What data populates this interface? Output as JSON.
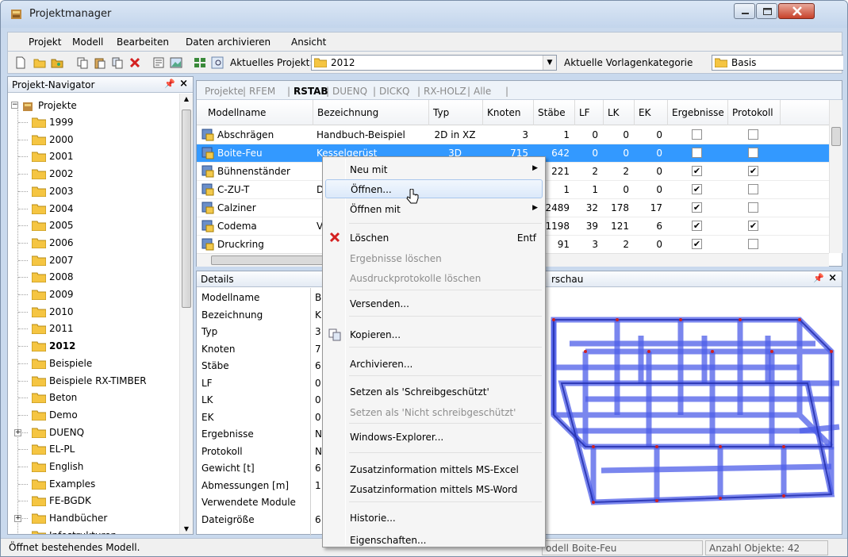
{
  "window": {
    "title": "Projektmanager"
  },
  "menubar": {
    "items": [
      "Projekt",
      "Modell",
      "Bearbeiten",
      "Daten archivieren",
      "Ansicht"
    ]
  },
  "toolbar": {
    "current_project_label": "Aktuelles Projekt:",
    "current_project_value": "2012",
    "template_category_label": "Aktuelle Vorlagenkategorie",
    "template_category_value": "Basis"
  },
  "navigator": {
    "title": "Projekt-Navigator",
    "root": "Projekte",
    "items": [
      "1999",
      "2000",
      "2001",
      "2002",
      "2003",
      "2004",
      "2005",
      "2006",
      "2007",
      "2008",
      "2009",
      "2010",
      "2011",
      "2012",
      "Beispiele",
      "Beispiele RX-TIMBER",
      "Beton",
      "Demo",
      "DUENQ",
      "EL-PL",
      "English",
      "Examples",
      "FE-BGDK",
      "Handbücher",
      "Infostrukturen"
    ],
    "selected": "2012"
  },
  "tabs": [
    "Projekte",
    "RFEM",
    "RSTAB",
    "DUENQ",
    "DICKQ",
    "RX-HOLZ",
    "Alle"
  ],
  "active_tab": "RSTAB",
  "table": {
    "columns": [
      "Modellname",
      "Bezeichnung",
      "Typ",
      "Knoten",
      "Stäbe",
      "LF",
      "LK",
      "EK",
      "Ergebnisse",
      "Protokoll"
    ],
    "rows": [
      {
        "name": "Abschrägen",
        "bez": "Handbuch-Beispiel",
        "typ": "2D in XZ",
        "knoten": "3",
        "staebe": "1",
        "lf": "0",
        "lk": "0",
        "ek": "0",
        "erg": false,
        "prot": false
      },
      {
        "name": "Boite-Feu",
        "bez": "Kesselgerüst",
        "typ": "3D",
        "knoten": "715",
        "staebe": "642",
        "lf": "0",
        "lk": "0",
        "ek": "0",
        "erg": false,
        "prot": false
      },
      {
        "name": "Bühnenständer",
        "bez": "",
        "typ": "",
        "knoten": "",
        "staebe": "221",
        "lf": "2",
        "lk": "2",
        "ek": "0",
        "erg": true,
        "prot": true
      },
      {
        "name": "C-ZU-T",
        "bez": "D",
        "typ": "",
        "knoten": "",
        "staebe": "1",
        "lf": "1",
        "lk": "0",
        "ek": "0",
        "erg": true,
        "prot": false
      },
      {
        "name": "Calziner",
        "bez": "",
        "typ": "",
        "knoten": "",
        "staebe": "2489",
        "lf": "32",
        "lk": "178",
        "ek": "17",
        "erg": true,
        "prot": false
      },
      {
        "name": "Codema",
        "bez": "V",
        "typ": "",
        "knoten": "",
        "staebe": "1198",
        "lf": "39",
        "lk": "121",
        "ek": "6",
        "erg": true,
        "prot": true
      },
      {
        "name": "Druckring",
        "bez": "",
        "typ": "",
        "knoten": "",
        "staebe": "91",
        "lf": "3",
        "lk": "2",
        "ek": "0",
        "erg": true,
        "prot": false
      }
    ]
  },
  "details": {
    "title": "Details",
    "labels": [
      "Modellname",
      "Bezeichnung",
      "Typ",
      "Knoten",
      "Stäbe",
      "LF",
      "LK",
      "EK",
      "Ergebnisse",
      "Protokoll",
      "Gewicht [t]",
      "Abmessungen [m]",
      "Verwendete Module",
      "Dateigröße"
    ],
    "values": [
      "B",
      "K",
      "3",
      "7",
      "6",
      "0",
      "0",
      "0",
      "N",
      "N",
      "6",
      "1",
      "",
      "6"
    ]
  },
  "preview": {
    "title": "rschau"
  },
  "context_menu": {
    "items": [
      {
        "label": "Neu mit",
        "submenu": true
      },
      {
        "label": "Öffnen...",
        "hover": true
      },
      {
        "label": "Öffnen mit",
        "submenu": true
      },
      {
        "label": "Löschen",
        "shortcut": "Entf",
        "icon": "delete-icon"
      },
      {
        "label": "Ergebnisse löschen",
        "disabled": true
      },
      {
        "label": "Ausdruckprotokolle löschen",
        "disabled": true
      },
      {
        "label": "Versenden..."
      },
      {
        "label": "Kopieren...",
        "icon": "copy-icon"
      },
      {
        "label": "Archivieren..."
      },
      {
        "label": "Setzen als 'Schreibgeschützt'"
      },
      {
        "label": "Setzen als 'Nicht schreibgeschützt'",
        "disabled": true
      },
      {
        "label": "Windows-Explorer..."
      },
      {
        "label": "Zusatzinformation mittels MS-Excel"
      },
      {
        "label": "Zusatzinformation mittels MS-Word"
      },
      {
        "label": "Historie..."
      },
      {
        "label": "Eigenschaften..."
      }
    ]
  },
  "statusbar": {
    "message": "Öffnet bestehendes Modell.",
    "model": "odell Boite-Feu",
    "objects": "Anzahl Objekte: 42"
  },
  "colors": {
    "selection": "#3399ff",
    "folder": "#f5c542",
    "model_blue": "#4d5ee8"
  }
}
